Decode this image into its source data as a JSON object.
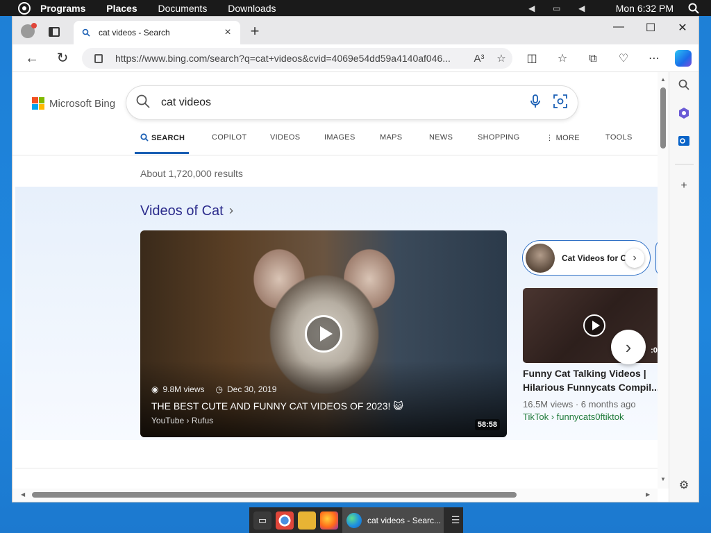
{
  "top_panel": {
    "menus": [
      "Programs",
      "Places",
      "Documents",
      "Downloads"
    ],
    "clock": "Mon 6:32 PM",
    "icons": [
      "system-menu-icon",
      "arrow-left-icon",
      "network-icon",
      "volume-icon",
      "search-icon"
    ]
  },
  "browser": {
    "tab": {
      "title": "cat videos - Search",
      "close": "×"
    },
    "new_tab": "+",
    "window_controls": {
      "minimize": "—",
      "maximize": "☐",
      "close": "✕"
    },
    "url": "https://www.bing.com/search?q=cat+videos&cvid=4069e54dd59a4140af046...",
    "read_aloud": "A³"
  },
  "bing": {
    "logo_text": "Microsoft Bing",
    "logo_colors": [
      "#f25022",
      "#7fba00",
      "#00a4ef",
      "#ffb900"
    ],
    "query": "cat videos",
    "scopes": [
      "SEARCH",
      "COPILOT",
      "VIDEOS",
      "IMAGES",
      "MAPS",
      "NEWS",
      "SHOPPING",
      "MORE",
      "TOOLS"
    ],
    "active_scope": "SEARCH",
    "results_count": "About 1,720,000 results",
    "videos_section": {
      "title": "Videos of Cat",
      "main_video": {
        "views": "9.8M views",
        "date": "Dec 30, 2019",
        "title": "THE BEST CUTE AND FUNNY CAT VIDEOS OF 2023! 😺",
        "source": "YouTube › Rufus",
        "duration": "58:58"
      },
      "pill": {
        "label": "Cat Videos for C"
      },
      "side_video": {
        "duration": ":05",
        "title": "Funny Cat Talking Videos | Hilarious Funnycats Compil...",
        "stats": "16.5M views · 6 months ago",
        "source": "TikTok › funnycats0ftiktok"
      }
    }
  },
  "taskbar": {
    "active_label": "cat videos - Searc..."
  }
}
